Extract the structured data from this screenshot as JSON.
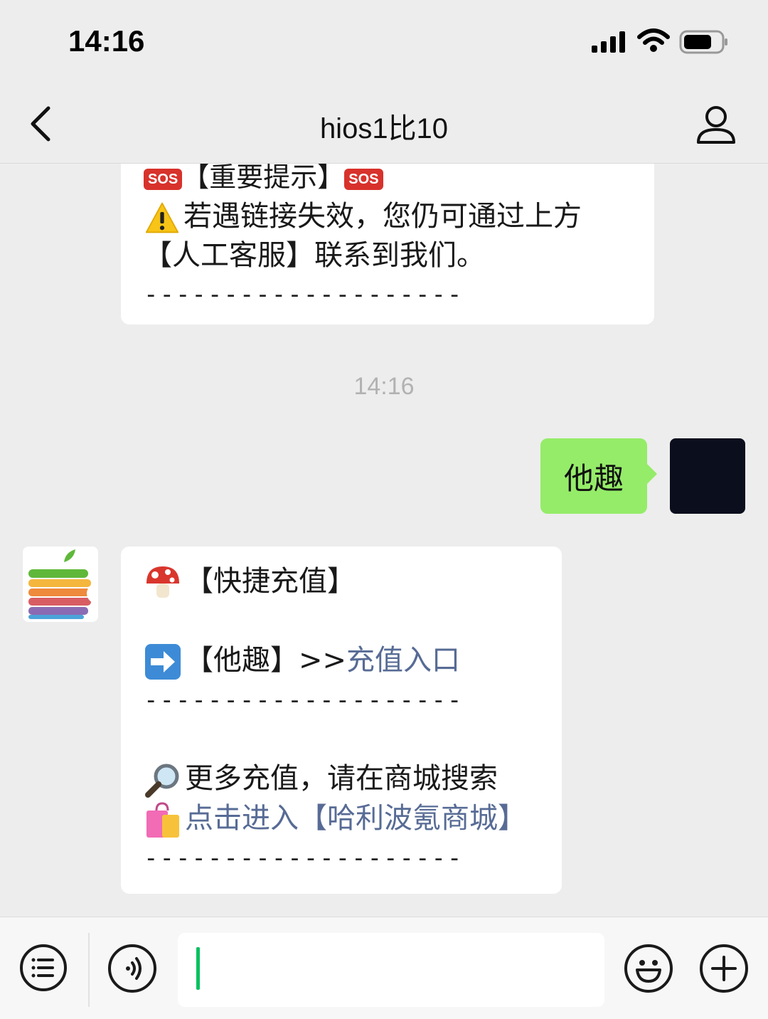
{
  "status_bar": {
    "time": "14:16"
  },
  "nav": {
    "title": "hios1比10"
  },
  "messages": {
    "first": {
      "sos_label": "SOS",
      "notice_title": "【重要提示】",
      "line1": "若遇链接失效，您仍可通过上方",
      "line2": "【人工客服】联系到我们。",
      "dashes": "--------------------"
    },
    "timestamp": "14:16",
    "outgoing": {
      "text": "他趣"
    },
    "reply": {
      "line_quick": "【快捷充值】",
      "line_entry_prefix": "【他趣】>>",
      "line_entry_link": "充值入口",
      "dashes": "--------------------",
      "line_more": "更多充值，请在商城搜索",
      "line_mall_link": "点击进入【哈利波氪商城】",
      "dashes2": "--------------------"
    }
  },
  "colors": {
    "background": "#ededed",
    "bubble_green": "#95ec69",
    "link": "#576b95",
    "caret": "#07c160"
  },
  "icons": {
    "back": "chevron-left-icon",
    "profile": "person-icon",
    "list": "list-icon",
    "voice": "voice-icon",
    "emoji": "smiley-icon",
    "add": "plus-icon"
  }
}
